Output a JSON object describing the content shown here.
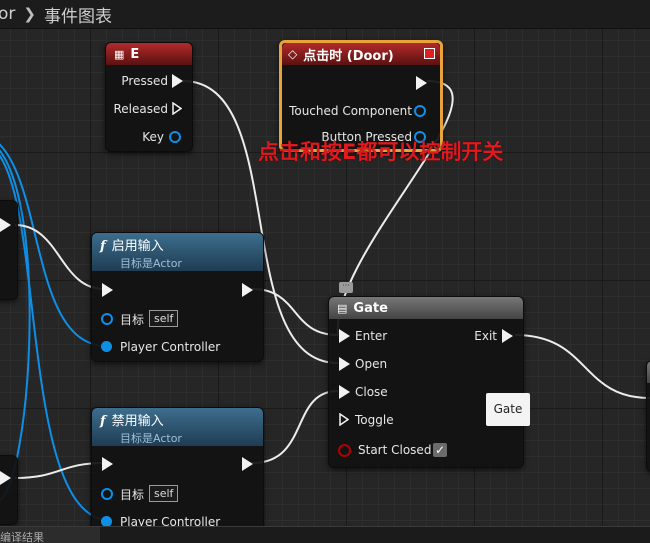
{
  "breadcrumb": {
    "parent": "or",
    "current": "事件图表"
  },
  "annotation": "点击和按E都可以控制开关",
  "nodes": {
    "key_e": {
      "title": "E",
      "pins": {
        "pressed": "Pressed",
        "released": "Released",
        "key": "Key"
      }
    },
    "on_clicked": {
      "title": "点击时 (Door)",
      "pins": {
        "touched": "Touched Component",
        "button": "Button Pressed"
      }
    },
    "enable_input": {
      "title": "启用输入",
      "subtitle": "目标是Actor",
      "pins": {
        "target": "目标",
        "target_value": "self",
        "controller": "Player Controller"
      }
    },
    "disable_input": {
      "title": "禁用输入",
      "subtitle": "目标是Actor",
      "pins": {
        "target": "目标",
        "target_value": "self",
        "controller": "Player Controller"
      }
    },
    "gate": {
      "title": "Gate",
      "pins": {
        "enter": "Enter",
        "open": "Open",
        "close": "Close",
        "toggle": "Toggle",
        "start_closed": "Start Closed",
        "exit": "Exit"
      }
    }
  },
  "tooltip": "Gate",
  "status_tab": "编译结果",
  "colors": {
    "event_header": "#b32a2a",
    "function_header": "#3d6e8e",
    "object_pin": "#0e8fe6",
    "bool_pin": "#b00000",
    "annotation": "#e0191f",
    "selection": "#e8a33a"
  }
}
